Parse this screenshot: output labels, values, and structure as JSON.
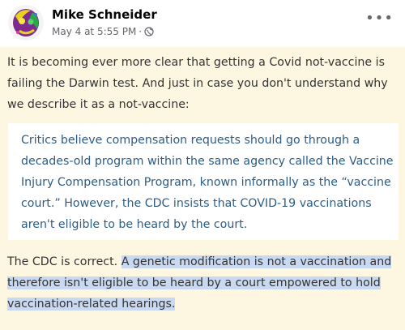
{
  "post": {
    "author": "Mike Schneider",
    "timestamp": "May 4 at 5:55 PM",
    "separator": "·",
    "more_label": "•••",
    "intro": "It is becoming ever more clear that getting a Covid not-vaccine is failing the Darwin test. And just in case you don't understand why we describe it as a not-vaccine:",
    "quote": "Critics believe compensation requests should go through a decades-old program within the same agency called the Vaccine Injury Compensation Program, known informally as the “vaccine court.” However, the CDC insists that COVID-19 vaccinations aren't eligible to be heard by the court.",
    "closing_plain": "The CDC is correct. ",
    "closing_highlighted": "A genetic modification is not a vaccination and therefore isn't eligible to be heard by a court empowered to hold vaccination-related hearings."
  },
  "colors": {
    "post_background": "#fdf7e2",
    "quote_text": "#2e5c85",
    "highlight": "#c9d9f1"
  },
  "icons": {
    "avatar": "avatar",
    "privacy": "globe-icon",
    "menu": "more-options-icon"
  }
}
